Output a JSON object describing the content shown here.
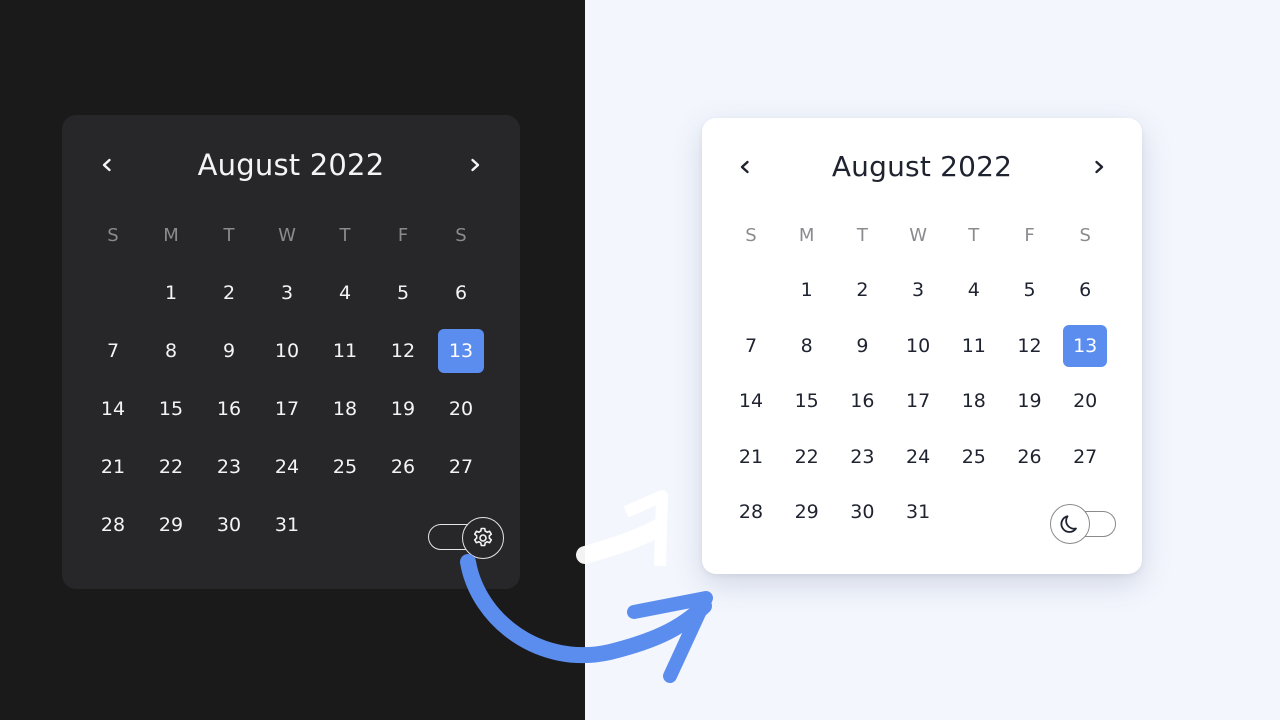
{
  "colors": {
    "dark_bg": "#1a1a1a",
    "light_bg": "#f3f6fd",
    "dark_card": "#27272a",
    "light_card": "#ffffff",
    "dark_text": "#f4f4f5",
    "light_text": "#1f2330",
    "dow_text": "#8b8b8f",
    "accent": "#5b8def",
    "arrow": "#5b8def",
    "dark_toggle_line": "#e5e5e5",
    "light_toggle_line": "#8a8a8a"
  },
  "dark_calendar": {
    "title": "August 2022",
    "prev_icon": "chevron-left-icon",
    "next_icon": "chevron-right-icon",
    "weekdays": [
      "S",
      "M",
      "T",
      "W",
      "T",
      "F",
      "S"
    ],
    "days": [
      "",
      "1",
      "2",
      "3",
      "4",
      "5",
      "6",
      "7",
      "8",
      "9",
      "10",
      "11",
      "12",
      "13",
      "14",
      "15",
      "16",
      "17",
      "18",
      "19",
      "20",
      "21",
      "22",
      "23",
      "24",
      "25",
      "26",
      "27",
      "28",
      "29",
      "30",
      "31"
    ],
    "today": "13",
    "toggle_icon": "gear-icon"
  },
  "light_calendar": {
    "title": "August 2022",
    "prev_icon": "chevron-left-icon",
    "next_icon": "chevron-right-icon",
    "weekdays": [
      "S",
      "M",
      "T",
      "W",
      "T",
      "F",
      "S"
    ],
    "days": [
      "",
      "1",
      "2",
      "3",
      "4",
      "5",
      "6",
      "7",
      "8",
      "9",
      "10",
      "11",
      "12",
      "13",
      "14",
      "15",
      "16",
      "17",
      "18",
      "19",
      "20",
      "21",
      "22",
      "23",
      "24",
      "25",
      "26",
      "27",
      "28",
      "29",
      "30",
      "31"
    ],
    "today": "13",
    "toggle_icon": "moon-icon"
  },
  "decor": {
    "arrow_icon": "curved-arrow-icon"
  }
}
